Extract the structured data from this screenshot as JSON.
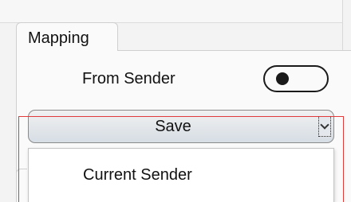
{
  "tabs": [
    {
      "label": "Mapping"
    }
  ],
  "mapping": {
    "from_sender_label": "From Sender",
    "toggle_state": "off",
    "select": {
      "value": "Save",
      "options": [
        "Current Sender"
      ]
    }
  },
  "colors": {
    "highlight": "#e23b3b"
  }
}
